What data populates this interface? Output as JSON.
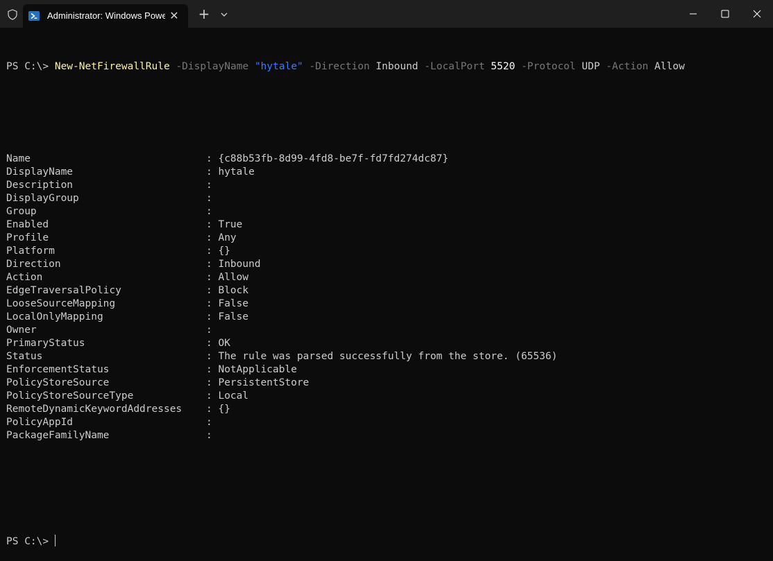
{
  "window": {
    "tab_title": "Administrator: Windows Powe",
    "icons": [
      "shield-icon",
      "powershell-icon",
      "close-icon",
      "plus-icon",
      "chevron-down-icon",
      "minimize-icon",
      "maximize-icon",
      "window-close-icon"
    ]
  },
  "command": {
    "prompt": "PS C:\\> ",
    "cmdlet": "New-NetFirewallRule",
    "p1": " -DisplayName ",
    "v1": "\"hytale\"",
    "p2": " -Direction ",
    "v2": "Inbound",
    "p3": " -LocalPort ",
    "v3": "5520",
    "p4": " -Protocol ",
    "v4": "UDP",
    "p5": " -Action ",
    "v5": "Allow"
  },
  "output": [
    {
      "key": "Name",
      "value": ": {c88b53fb-8d99-4fd8-be7f-fd7fd274dc87}"
    },
    {
      "key": "DisplayName",
      "value": ": hytale"
    },
    {
      "key": "Description",
      "value": ":"
    },
    {
      "key": "DisplayGroup",
      "value": ":"
    },
    {
      "key": "Group",
      "value": ":"
    },
    {
      "key": "Enabled",
      "value": ": True"
    },
    {
      "key": "Profile",
      "value": ": Any"
    },
    {
      "key": "Platform",
      "value": ": {}"
    },
    {
      "key": "Direction",
      "value": ": Inbound"
    },
    {
      "key": "Action",
      "value": ": Allow"
    },
    {
      "key": "EdgeTraversalPolicy",
      "value": ": Block"
    },
    {
      "key": "LooseSourceMapping",
      "value": ": False"
    },
    {
      "key": "LocalOnlyMapping",
      "value": ": False"
    },
    {
      "key": "Owner",
      "value": ":"
    },
    {
      "key": "PrimaryStatus",
      "value": ": OK"
    },
    {
      "key": "Status",
      "value": ": The rule was parsed successfully from the store. (65536)"
    },
    {
      "key": "EnforcementStatus",
      "value": ": NotApplicable"
    },
    {
      "key": "PolicyStoreSource",
      "value": ": PersistentStore"
    },
    {
      "key": "PolicyStoreSourceType",
      "value": ": Local"
    },
    {
      "key": "RemoteDynamicKeywordAddresses",
      "value": ": {}"
    },
    {
      "key": "PolicyAppId",
      "value": ":"
    },
    {
      "key": "PackageFamilyName",
      "value": ":"
    }
  ],
  "final_prompt": "PS C:\\>",
  "colors": {
    "background": "#0c0c0c",
    "titlebar": "#1f1f1f",
    "cmdlet": "#f9f1a5",
    "parameter": "#767676",
    "string": "#3b78ff"
  }
}
